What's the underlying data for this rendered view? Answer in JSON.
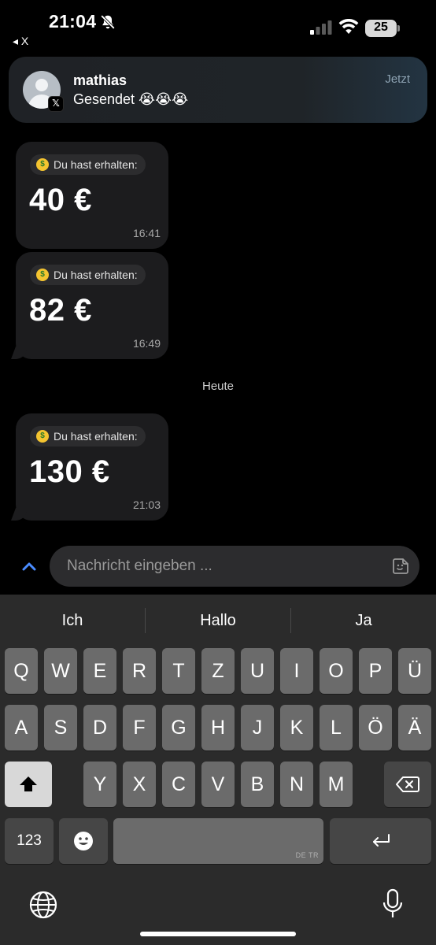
{
  "status_bar": {
    "time": "21:04",
    "back_app": "◂ X",
    "battery": "25"
  },
  "notification": {
    "sender": "mathias",
    "message": "Gesendet 😭😭😭",
    "time": "Jetzt",
    "app_badge": "𝕏"
  },
  "chat": {
    "messages": [
      {
        "label": "Du hast erhalten:",
        "amount": "40 €",
        "time": "16:41"
      },
      {
        "label": "Du hast erhalten:",
        "amount": "82 €",
        "time": "16:49"
      },
      {
        "label": "Du hast erhalten:",
        "amount": "130 €",
        "time": "21:03"
      }
    ],
    "date_divider": "Heute"
  },
  "composer": {
    "placeholder": "Nachricht eingeben ..."
  },
  "keyboard": {
    "suggestions": [
      "Ich",
      "Hallo",
      "Ja"
    ],
    "row1": [
      "Q",
      "W",
      "E",
      "R",
      "T",
      "Z",
      "U",
      "I",
      "O",
      "P",
      "Ü"
    ],
    "row2": [
      "A",
      "S",
      "D",
      "F",
      "G",
      "H",
      "J",
      "K",
      "L",
      "Ö",
      "Ä"
    ],
    "row3": [
      "Y",
      "X",
      "C",
      "V",
      "B",
      "N",
      "M"
    ],
    "numbers_label": "123",
    "space_lang": "DE TR"
  },
  "colors": {
    "background": "#000000",
    "bubble": "#1c1c1e",
    "keyboard": "#2b2b2b",
    "key": "#6b6b6b",
    "key_dark": "#464646",
    "accent": "#4a8cff"
  }
}
